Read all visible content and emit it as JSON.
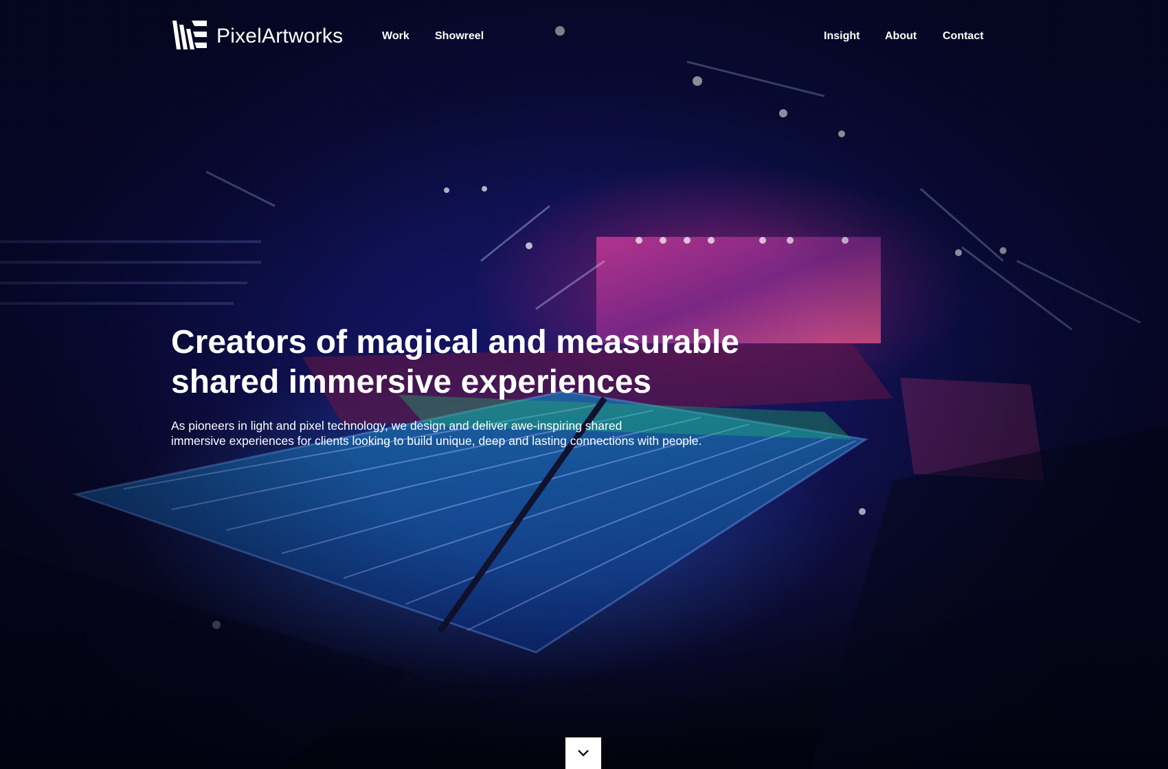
{
  "brand": {
    "name": "PixelArtworks",
    "logo_icon": "pixelartworks-logo-icon"
  },
  "nav": {
    "left": [
      {
        "label": "Work"
      },
      {
        "label": "Showreel"
      }
    ],
    "right": [
      {
        "label": "Insight"
      },
      {
        "label": "About"
      },
      {
        "label": "Contact"
      }
    ]
  },
  "hero": {
    "headline_line1": "Creators of magical and measurable",
    "headline_line2": "shared immersive experiences",
    "subtext_line1": "As pioneers in light and pixel technology, we design and deliver awe-inspiring shared",
    "subtext_line2": "immersive experiences for clients looking to build unique, deep and lasting connections with people.",
    "scroll_icon": "chevron-down-icon"
  },
  "colors": {
    "text": "#ffffff",
    "background": "#0a0c3a",
    "accent_pink": "#dc2878",
    "pool_blue": "#2a6ec8"
  }
}
